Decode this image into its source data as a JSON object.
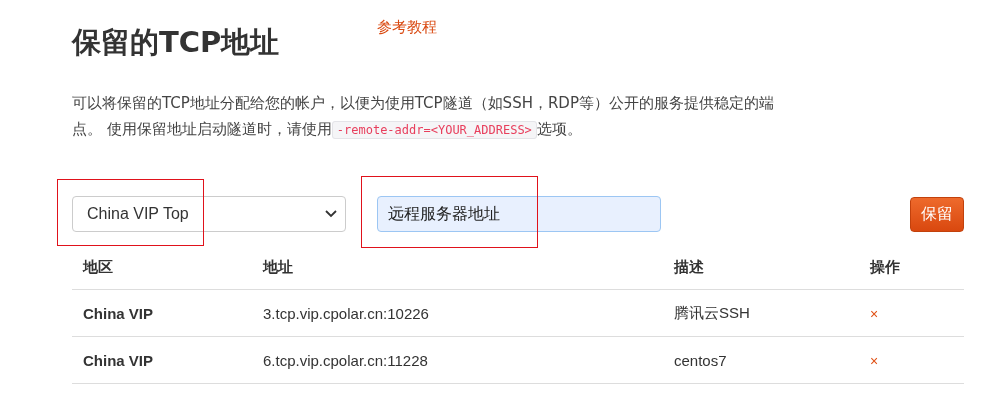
{
  "title": "保留的TCP地址",
  "tutorial_link": "参考教程",
  "description": {
    "before": "可以将保留的TCP地址分配给您的帐户，以便为使用TCP隧道（如SSH，RDP等）公开的服务提供稳定的端点。 使用保留地址启动隧道时，请使用",
    "code": "-remote-addr=<YOUR_ADDRESS>",
    "after": "选项。"
  },
  "form": {
    "region": "China VIP Top",
    "description_value": "远程服务器地址",
    "submit": "保留"
  },
  "table": {
    "columns": [
      "地区",
      "地址",
      "描述",
      "操作"
    ],
    "rows": [
      {
        "region": "China VIP",
        "address": "3.tcp.vip.cpolar.cn:10226",
        "description": "腾讯云SSH",
        "action": "×"
      },
      {
        "region": "China VIP",
        "address": "6.tcp.vip.cpolar.cn:11228",
        "description": "centos7",
        "action": "×"
      }
    ]
  }
}
